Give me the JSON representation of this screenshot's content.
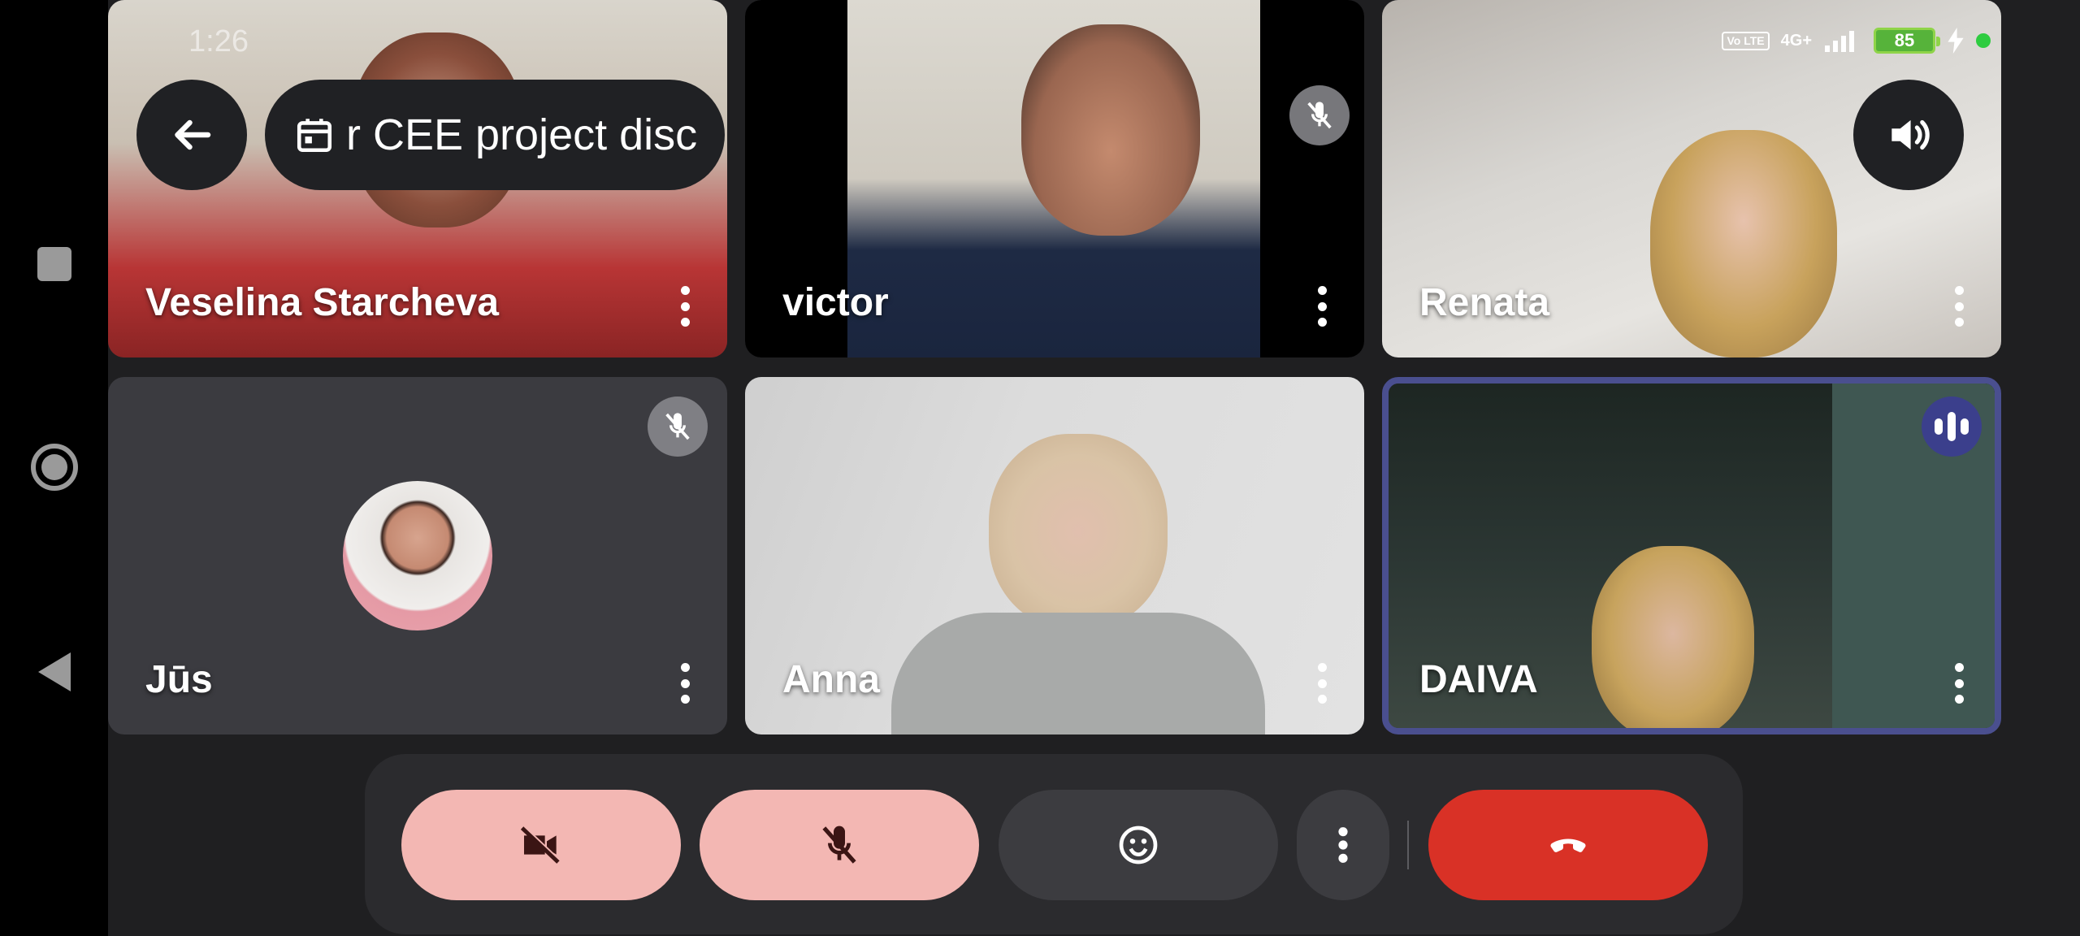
{
  "meeting": {
    "title": "r CEE project disc",
    "clock": "1:26"
  },
  "status_bar": {
    "volte": "Vo LTE",
    "network": "4G+",
    "battery": "85",
    "charging_icon": "bolt-icon",
    "indicator_color": "#2ecc40"
  },
  "participants": [
    {
      "name": "Veselina Starcheva",
      "muted": false,
      "speaking": false
    },
    {
      "name": "victor",
      "muted": true,
      "speaking": false
    },
    {
      "name": "Renata",
      "muted": false,
      "speaking": false
    },
    {
      "name": "Jūs",
      "muted": true,
      "speaking": false,
      "video": false
    },
    {
      "name": "Anna",
      "muted": false,
      "speaking": false
    },
    {
      "name": "DAIVA",
      "muted": false,
      "speaking": true
    }
  ],
  "controls": {
    "camera": "camera-off-icon",
    "mic": "mic-off-icon",
    "reactions": "emoji-icon",
    "more": "more-vert-icon",
    "end_call": "call-end-icon"
  },
  "colors": {
    "accent_pink": "#f3b7b3",
    "end_call_red": "#d93126",
    "active_speaker_border": "#4a4f8f",
    "speaking_badge": "#3b3f8c"
  }
}
